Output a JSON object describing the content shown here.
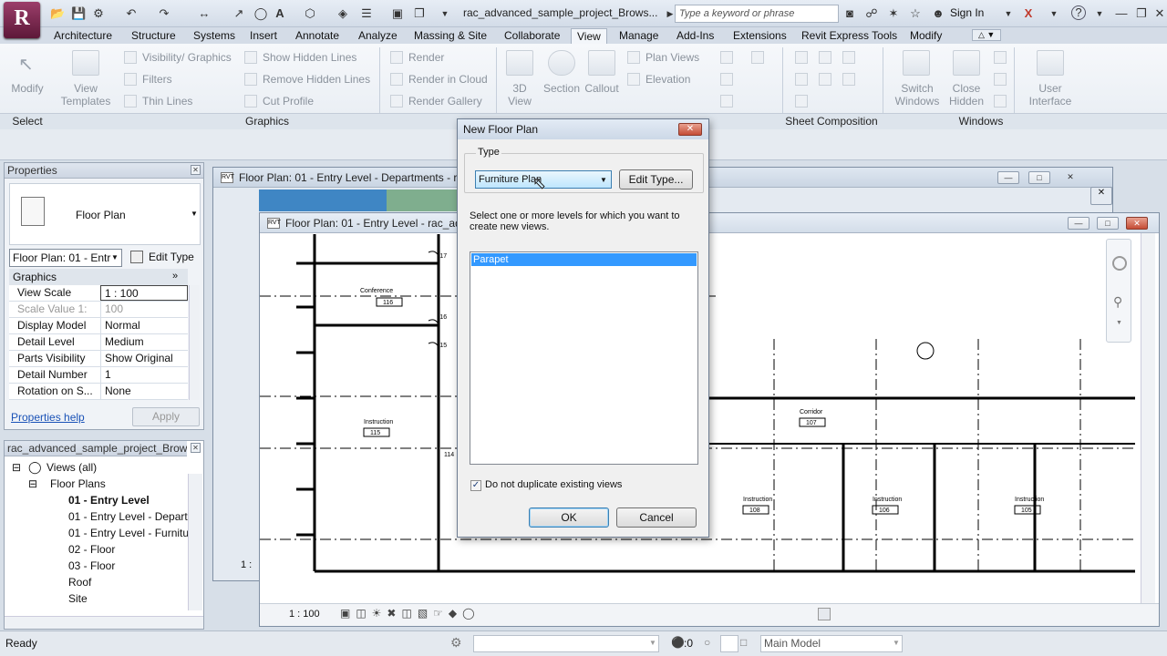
{
  "titlebar": {
    "logo": "R",
    "document_title": "rac_advanced_sample_project_Brows...",
    "search_placeholder": "Type a keyword or phrase",
    "sign_in": "Sign In"
  },
  "tabs": [
    "Architecture",
    "Structure",
    "Systems",
    "Insert",
    "Annotate",
    "Analyze",
    "Massing & Site",
    "Collaborate",
    "View",
    "Manage",
    "Add-Ins",
    "Extensions",
    "Revit Express Tools",
    "Modify"
  ],
  "active_tab": "View",
  "ribbon": {
    "modify": "Modify",
    "view_templates": [
      "View",
      "Templates"
    ],
    "visibility_graphics": "Visibility/ Graphics",
    "filters": "Filters",
    "thin_lines": "Thin  Lines",
    "show_hidden_lines": "Show  Hidden Lines",
    "remove_hidden_lines": "Remove  Hidden Lines",
    "cut_profile": "Cut  Profile",
    "render": "Render",
    "render_in_cloud": "Render  in Cloud",
    "render_gallery": "Render  Gallery",
    "view_3d": [
      "3D",
      "View"
    ],
    "section": "Section",
    "callout": "Callout",
    "plan_views": "Plan  Views",
    "elevation": "Elevation",
    "switch_windows": [
      "Switch",
      "Windows"
    ],
    "close_hidden": [
      "Close",
      "Hidden"
    ],
    "user_interface": [
      "User",
      "Interface"
    ],
    "panels": {
      "select": "Select",
      "graphics": "Graphics",
      "sheet_composition": "Sheet Composition",
      "windows": "Windows"
    }
  },
  "properties": {
    "title": "Properties",
    "type_name": "Floor Plan",
    "instance_selector": "Floor Plan: 01 - Entr",
    "edit_type": "Edit Type",
    "group": "Graphics",
    "rows": [
      {
        "name": "View Scale",
        "value": "1 : 100"
      },
      {
        "name": "Scale Value    1:",
        "value": "100"
      },
      {
        "name": "Display Model",
        "value": "Normal"
      },
      {
        "name": "Detail Level",
        "value": "Medium"
      },
      {
        "name": "Parts Visibility",
        "value": "Show Original"
      },
      {
        "name": "Detail Number",
        "value": "1"
      },
      {
        "name": "Rotation on S...",
        "value": "None"
      }
    ],
    "help_link": "Properties help",
    "apply": "Apply"
  },
  "browser": {
    "title": "rac_advanced_sample_project_Brow...",
    "root": "Views (all)",
    "floor_plans": "Floor Plans",
    "items": [
      "01 - Entry Level",
      "01 - Entry Level - Depart",
      "01 - Entry Level - Furnitu",
      "02 - Floor",
      "03 - Floor",
      "Roof",
      "Site"
    ]
  },
  "views": {
    "back_title": "Floor Plan: 01 - Entry Level - Departments - ra",
    "front_title": "Floor Plan: 01 - Entry Level - rac_adv",
    "back_scale": "1 :",
    "front_scale": "1 : 100",
    "rooms": [
      {
        "name": "Conference",
        "number": "116"
      },
      {
        "name": "Instruction",
        "number": "115"
      },
      {
        "name": "Corridor",
        "number": "107"
      },
      {
        "name": "Instruction",
        "number": "108"
      },
      {
        "name": "Instruction",
        "number": "106"
      },
      {
        "name": "Instruction",
        "number": "105"
      }
    ],
    "door_tags": [
      "117",
      "116",
      "115",
      "114"
    ]
  },
  "dialog": {
    "title": "New Floor Plan",
    "type_label": "Type",
    "type_value": "Furniture Plan",
    "edit_type": "Edit Type...",
    "instruction": "Select one or more levels for which you want to create new views.",
    "levels": [
      "Parapet"
    ],
    "do_not_duplicate": "Do not duplicate existing views",
    "do_not_duplicate_checked": true,
    "ok": "OK",
    "cancel": "Cancel"
  },
  "status": {
    "text": "Ready",
    "filter_count": ":0",
    "model": "Main Model"
  }
}
